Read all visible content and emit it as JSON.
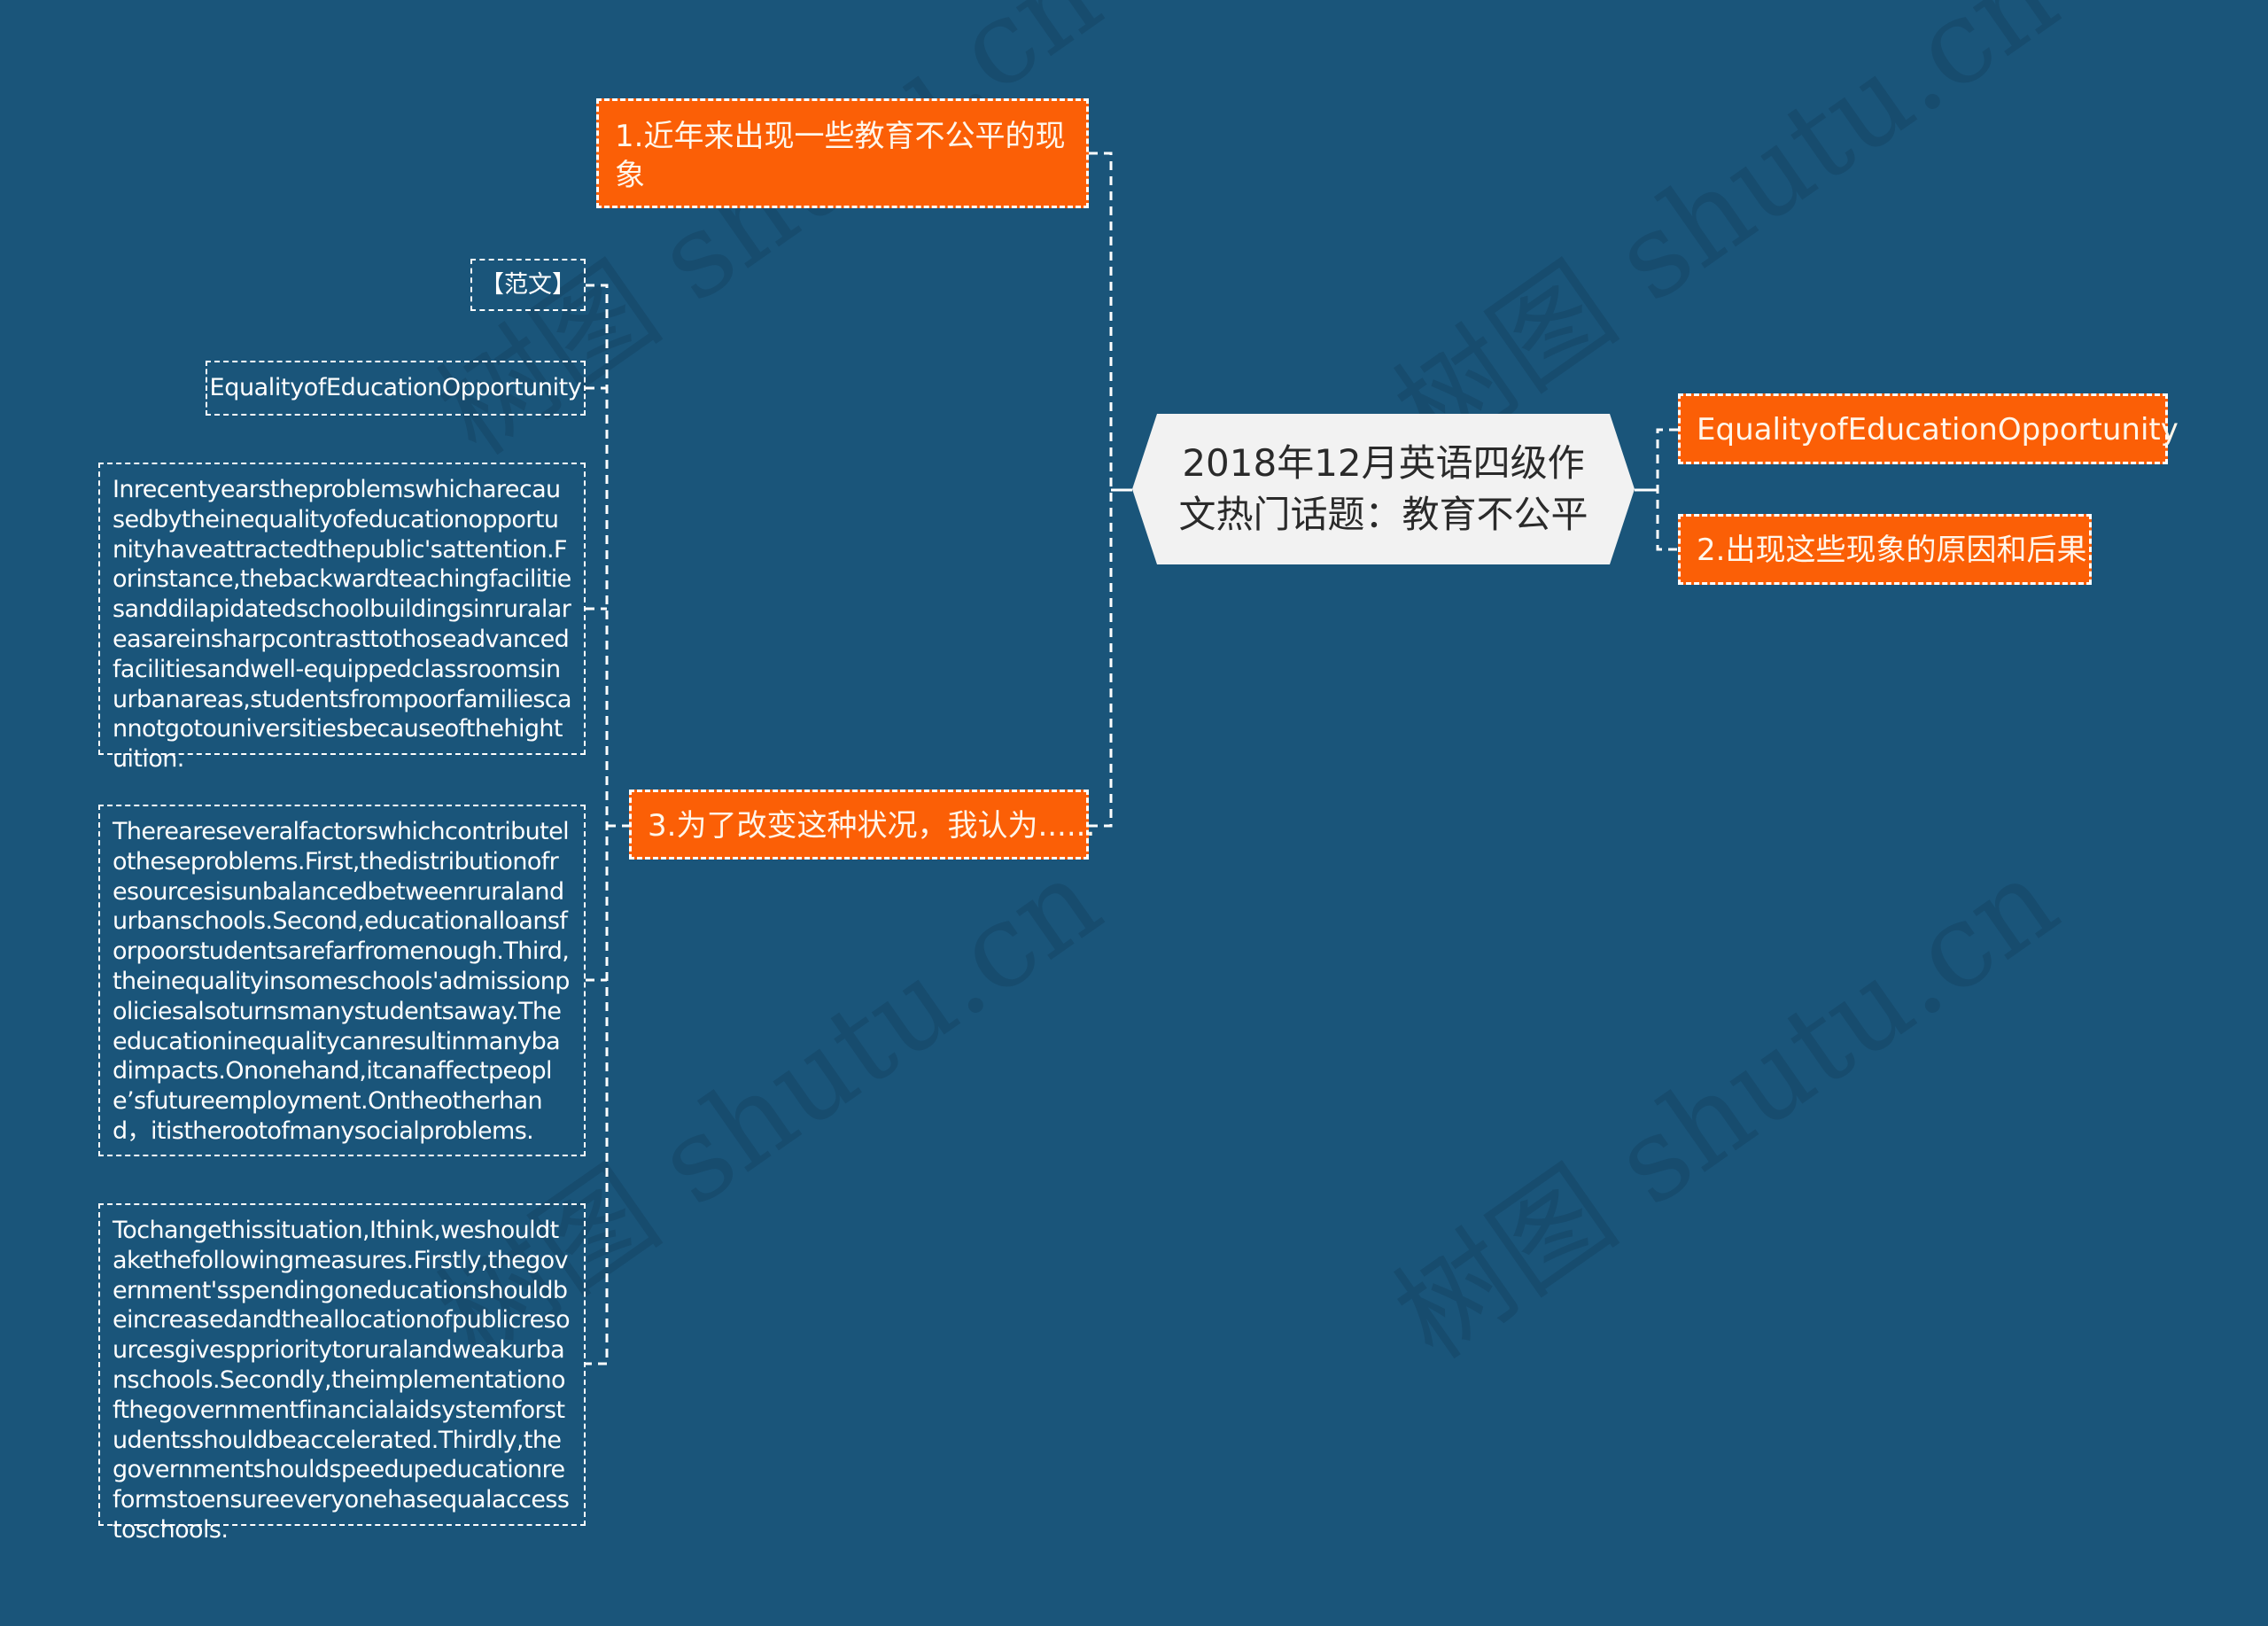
{
  "watermark": "树图 shutu.cn",
  "colors": {
    "background": "#1a557a",
    "branch_node": "#fb5f06",
    "root_node": "#f2f2f2",
    "connector": "#ffffff"
  },
  "root": {
    "label": "2018年12月英语四级作文热门话题：教育不公平"
  },
  "right_branches": [
    {
      "label": "EqualityofEducationOpportunity"
    },
    {
      "label": "2.出现这些现象的原因和后果"
    }
  ],
  "left_branches": [
    {
      "label": "1.近年来出现一些教育不公平的现象"
    },
    {
      "label": "3.为了改变这种状况，我认为......",
      "children": [
        {
          "label": "【范文】"
        },
        {
          "label": "EqualityofEducationOpportunity"
        },
        {
          "label": "Inrecentyearstheproblemswhicharecausedbytheinequalityofeducationopportunityhaveattractedthepublic'sattention.Forinstance,thebackwardteachingfacilitiesanddilapidatedschoolbuildingsinruralareasareinsharpcontrasttothoseadvancedfacilitiesandwell-equippedclassroomsinurbanareas,studentsfrompoorfamiliescannotgotouniversitiesbecauseofthehightuition."
        },
        {
          "label": "Thereareseveralfactorswhichcontributelotheseproblems.First,thedistributionofresourcesisunbalancedbetweenruralandurbanschools.Second,educationalloansforpoorstudentsarefarfromenough.Third,theinequalityinsomeschools'admissionpoliciesalsoturnsmanystudentsaway.Theeducationinequalitycanresultinmanybadimpacts.Ononehand,itcanaffectpeople’sfutureemployment.Ontheotherhand，itistherootofmanysocialproblems."
        },
        {
          "label": "Tochangethissituation,Ithink,weshouldtakethefollowingmeasures.Firstly,thegovernment'sspendingoneducationshouldbeincreasedandtheallocationofpublicresourcesgivespprioritytoruralandweakurbanschools.Secondly,theimplementationofthegovernmentfinancialaidsystemforstudentsshouldbeaccelerated.Thirdly,thegovernmentshouldspeedupeducationreformstoensureeveryonehasequalaccesstoschools."
        }
      ]
    }
  ]
}
